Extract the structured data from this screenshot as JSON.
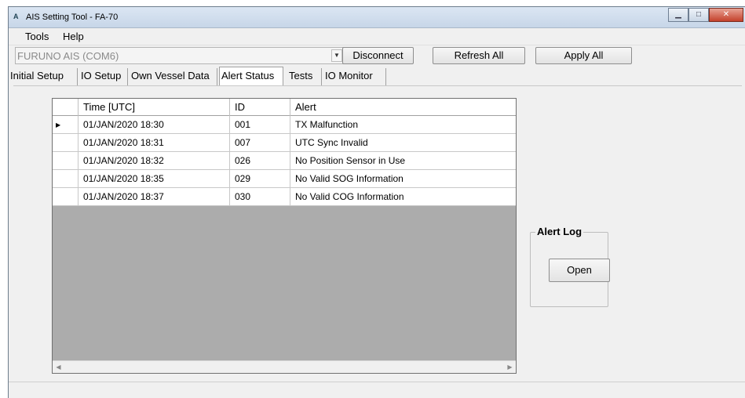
{
  "window": {
    "title": "AIS Setting Tool - FA-70",
    "icon_text": "A"
  },
  "menu": {
    "items": [
      "Tools",
      "Help"
    ]
  },
  "connection": {
    "port_value": "FURUNO AIS (COM6)",
    "disconnect_label": "Disconnect",
    "refresh_all_label": "Refresh All",
    "apply_all_label": "Apply All"
  },
  "tabs": [
    {
      "label": "Initial Setup"
    },
    {
      "label": "IO Setup"
    },
    {
      "label": "Own Vessel Data"
    },
    {
      "label": "Alert Status"
    },
    {
      "label": "Tests"
    },
    {
      "label": "IO Monitor"
    }
  ],
  "alert_table": {
    "columns": [
      "Time [UTC]",
      "ID",
      "Alert"
    ],
    "rows": [
      {
        "time": "01/JAN/2020 18:30",
        "id": "001",
        "alert": "TX Malfunction"
      },
      {
        "time": "01/JAN/2020 18:31",
        "id": "007",
        "alert": "UTC Sync Invalid"
      },
      {
        "time": "01/JAN/2020 18:32",
        "id": "026",
        "alert": "No Position Sensor in Use"
      },
      {
        "time": "01/JAN/2020 18:35",
        "id": "029",
        "alert": "No Valid SOG Information"
      },
      {
        "time": "01/JAN/2020 18:37",
        "id": "030",
        "alert": "No Valid COG Information"
      }
    ]
  },
  "alert_log": {
    "label": "Alert Log",
    "open_label": "Open"
  },
  "icons": {
    "row_selector": "selected-row-arrow-icon",
    "scroll_left": "scroll-left-icon",
    "scroll_right": "scroll-right-icon",
    "dropdown": "chevron-down-icon"
  },
  "colors": {
    "title_bar": "#c7d6e8",
    "window_bg": "#f0f0f0",
    "grid_empty": "#acacac"
  }
}
